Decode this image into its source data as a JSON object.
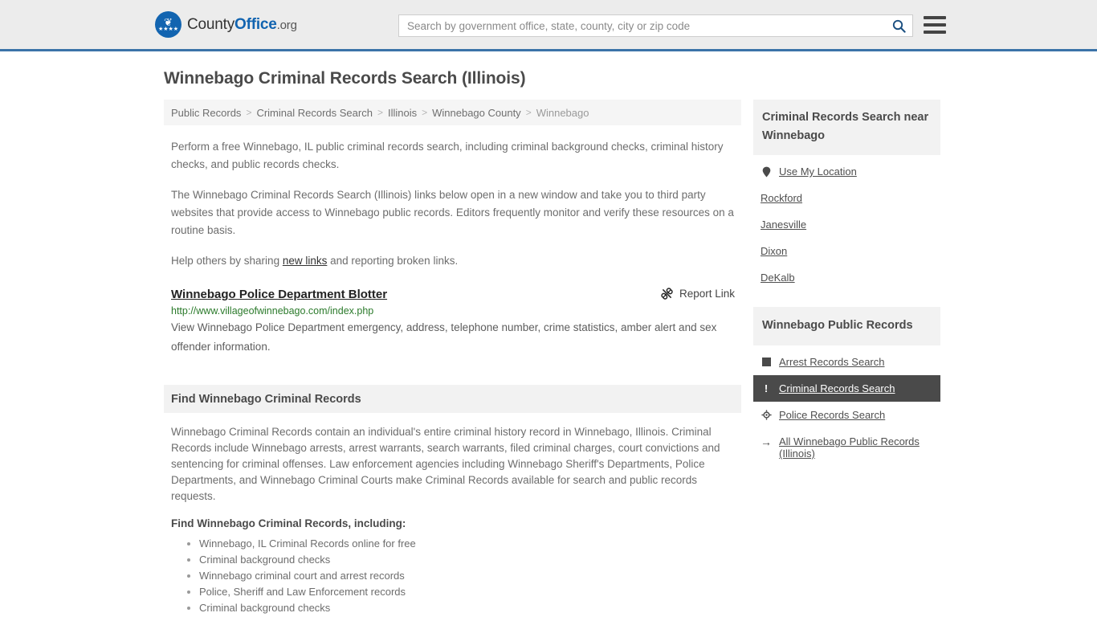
{
  "header": {
    "logo": {
      "prefix": "County",
      "bold": "Office",
      "suffix": ".org",
      "emblem_icon": "eagle-emblem-icon",
      "emblem_bird": "❦",
      "emblem_stars": "★★★★"
    },
    "search": {
      "placeholder": "Search by government office, state, county, city or zip code",
      "value": "",
      "search_icon": "search-icon"
    },
    "menu_icon": "hamburger-menu-icon",
    "accent_color": "#3b73a8",
    "background_color": "#ececec"
  },
  "page": {
    "title": "Winnebago Criminal Records Search (Illinois)"
  },
  "breadcrumb": {
    "separator": ">",
    "items": [
      {
        "label": "Public Records",
        "current": false
      },
      {
        "label": "Criminal Records Search",
        "current": false
      },
      {
        "label": "Illinois",
        "current": false
      },
      {
        "label": "Winnebago County",
        "current": false
      },
      {
        "label": "Winnebago",
        "current": true
      }
    ]
  },
  "intro": {
    "paragraph_1": "Perform a free Winnebago, IL public criminal records search, including criminal background checks, criminal history checks, and public records checks.",
    "paragraph_2": "The Winnebago Criminal Records Search (Illinois) links below open in a new window and take you to third party websites that provide access to Winnebago public records. Editors frequently monitor and verify these resources on a routine basis.",
    "help_prefix": "Help others by sharing ",
    "help_link": "new links",
    "help_suffix": " and reporting broken links."
  },
  "result": {
    "title": "Winnebago Police Department Blotter",
    "url": "http://www.villageofwinnebago.com/index.php",
    "description": "View Winnebago Police Department emergency, address, telephone number, crime statistics, amber alert and sex offender information.",
    "report_label": "Report Link",
    "report_icon": "broken-link-icon",
    "url_color": "#2b7a2b"
  },
  "find_section": {
    "heading": "Find Winnebago Criminal Records",
    "body": "Winnebago Criminal Records contain an individual's entire criminal history record in Winnebago, Illinois. Criminal Records include Winnebago arrests, arrest warrants, search warrants, filed criminal charges, court convictions and sentencing for criminal offenses. Law enforcement agencies including Winnebago Sheriff's Departments, Police Departments, and Winnebago Criminal Courts make Criminal Records available for search and public records requests.",
    "sub_heading": "Find Winnebago Criminal Records, including:",
    "bullets": [
      "Winnebago, IL Criminal Records online for free",
      "Criminal background checks",
      "Winnebago criminal court and arrest records",
      "Police, Sheriff and Law Enforcement records",
      "Criminal background checks"
    ]
  },
  "sidebar": {
    "nearby": {
      "heading": "Criminal Records Search near Winnebago",
      "use_my_location": {
        "label": "Use My Location",
        "icon": "map-pin-icon"
      },
      "cities": [
        {
          "label": "Rockford"
        },
        {
          "label": "Janesville"
        },
        {
          "label": "Dixon"
        },
        {
          "label": "DeKalb"
        }
      ]
    },
    "public_records": {
      "heading": "Winnebago Public Records",
      "items": [
        {
          "label": "Arrest Records Search",
          "icon": "square-icon",
          "glyph": "",
          "active": false
        },
        {
          "label": "Criminal Records Search",
          "icon": "exclamation-icon",
          "glyph": "!",
          "active": true
        },
        {
          "label": "Police Records Search",
          "icon": "target-icon",
          "glyph": "⊕",
          "active": false
        },
        {
          "label": "All Winnebago Public Records (Illinois)",
          "icon": "arrow-right-icon",
          "glyph": "→",
          "active": false
        }
      ],
      "active_bg": "#4a4a4a"
    }
  }
}
